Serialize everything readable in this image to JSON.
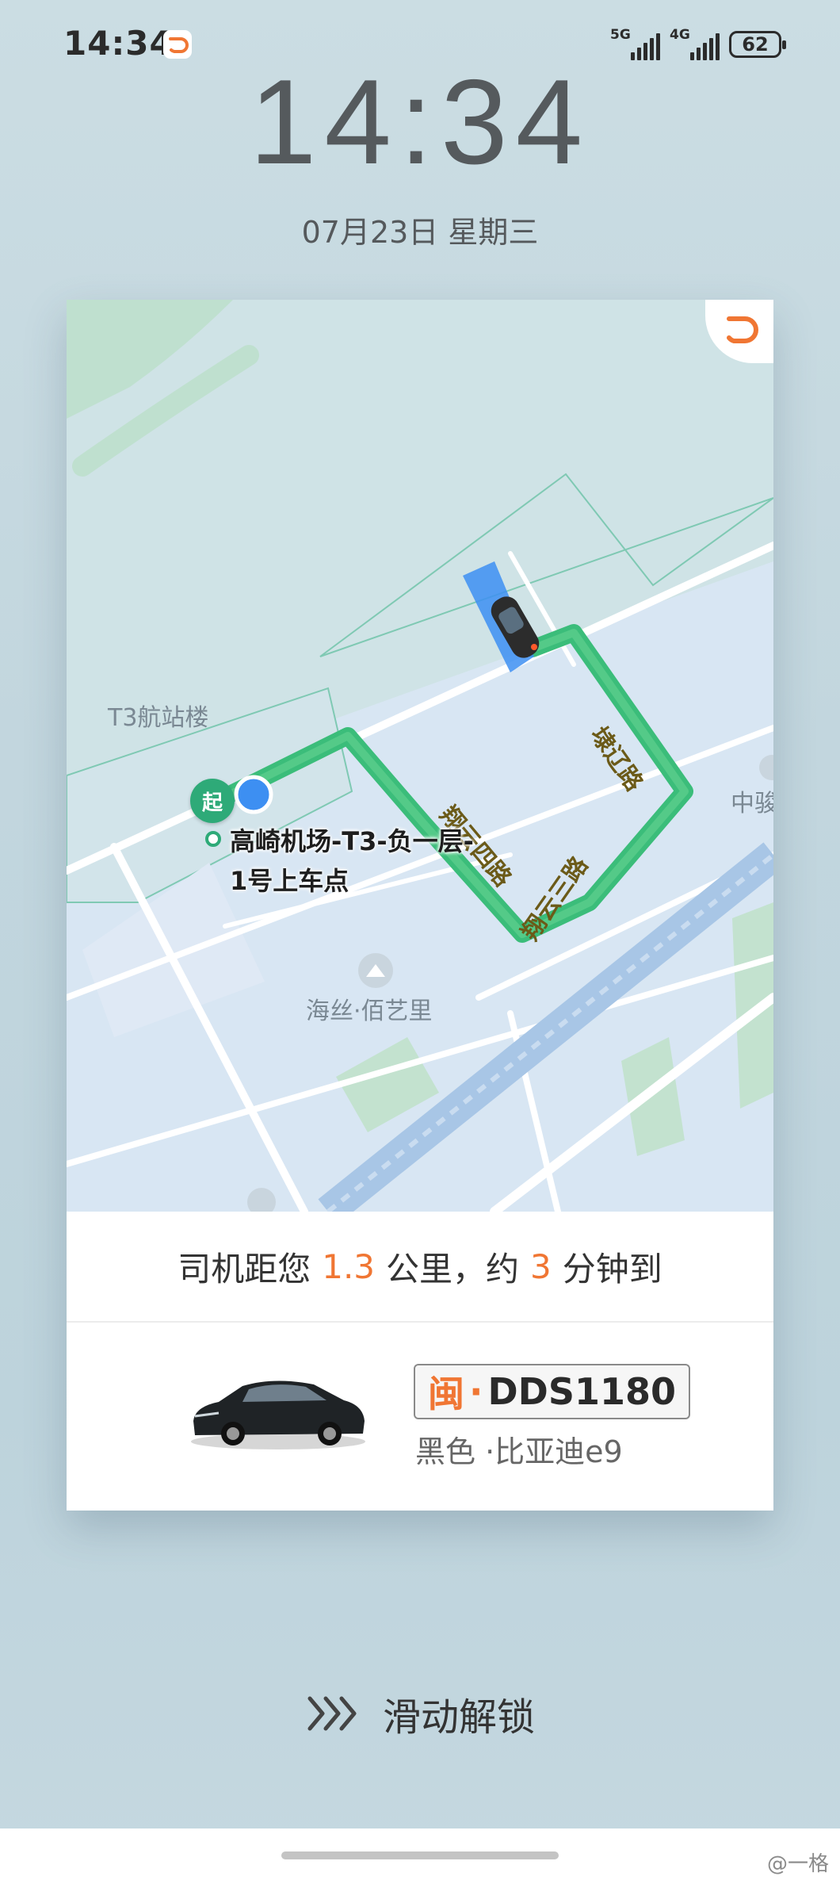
{
  "status_bar": {
    "time": "14:34",
    "network_1": "5G",
    "network_2": "4G",
    "battery": "62"
  },
  "lock_screen": {
    "time": "14:34",
    "date": "07月23日 星期三"
  },
  "ride_card": {
    "map": {
      "building_label": "T3航站楼",
      "poi_label": "海丝·佰艺里",
      "edge_label": "中骏",
      "pickup_line1": "高崎机场-T3-负一层-",
      "pickup_line2": "1号上车点",
      "start_pin": "起",
      "road_names": [
        "埭辽路",
        "翔云三路",
        "翔云四路"
      ]
    },
    "eta": {
      "prefix": "司机距您",
      "distance": "1.3",
      "mid": "公里，约",
      "minutes": "3",
      "suffix": "分钟到"
    },
    "car": {
      "plate_province": "闽",
      "plate_sep": "·",
      "plate_number": "DDS1180",
      "description": "黑色 ·比亚迪e9"
    }
  },
  "unlock": {
    "label": "滑动解锁",
    "icon": "triple-chevron-right-icon"
  },
  "watermark": "@一格",
  "colors": {
    "accent": "#f07633",
    "route": "#3bbd7a",
    "map_background": "#d9e6f4"
  }
}
